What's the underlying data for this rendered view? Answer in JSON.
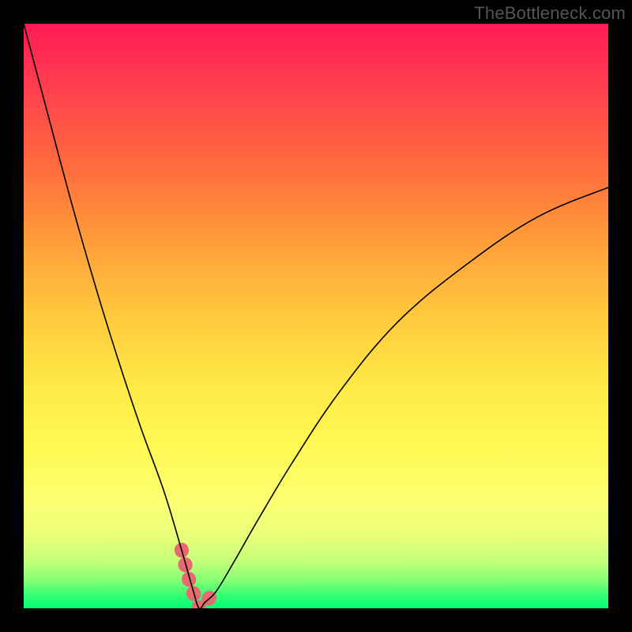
{
  "attribution": "TheBottleneck.com",
  "colors": {
    "frame": "#000000",
    "curve": "#000000",
    "highlight": "#e66a6f",
    "gradient_top": "#ff1a55",
    "gradient_mid": "#ffe946",
    "gradient_bottom": "#00ff74"
  },
  "chart_data": {
    "type": "line",
    "title": "",
    "xlabel": "",
    "ylabel": "",
    "x_range": [
      0,
      100
    ],
    "y_range": [
      0,
      100
    ],
    "ylim": [
      0,
      100
    ],
    "notes": "Axes are unlabeled; x likely represents relative GPU/CPU power and y the bottleneck percentage. Background gradient encodes bottleneck (red=high, green=low). Minimum of curve ≈ x=30, y≈0. Values estimated from pixel positions.",
    "series": [
      {
        "name": "bottleneck-curve",
        "x": [
          0,
          4,
          8,
          12,
          16,
          20,
          24,
          27,
          29,
          30,
          31,
          33,
          36,
          40,
          46,
          54,
          64,
          76,
          88,
          100
        ],
        "y": [
          100,
          85,
          70,
          56,
          43,
          31,
          20,
          10,
          3,
          0,
          1,
          3,
          8,
          15,
          25,
          37,
          49,
          59,
          67,
          72
        ]
      }
    ],
    "highlight_band": {
      "name": "optimal-range",
      "x": [
        27,
        28.5,
        30,
        31.5,
        33
      ],
      "y": [
        10,
        4,
        0,
        1.5,
        3
      ]
    }
  }
}
